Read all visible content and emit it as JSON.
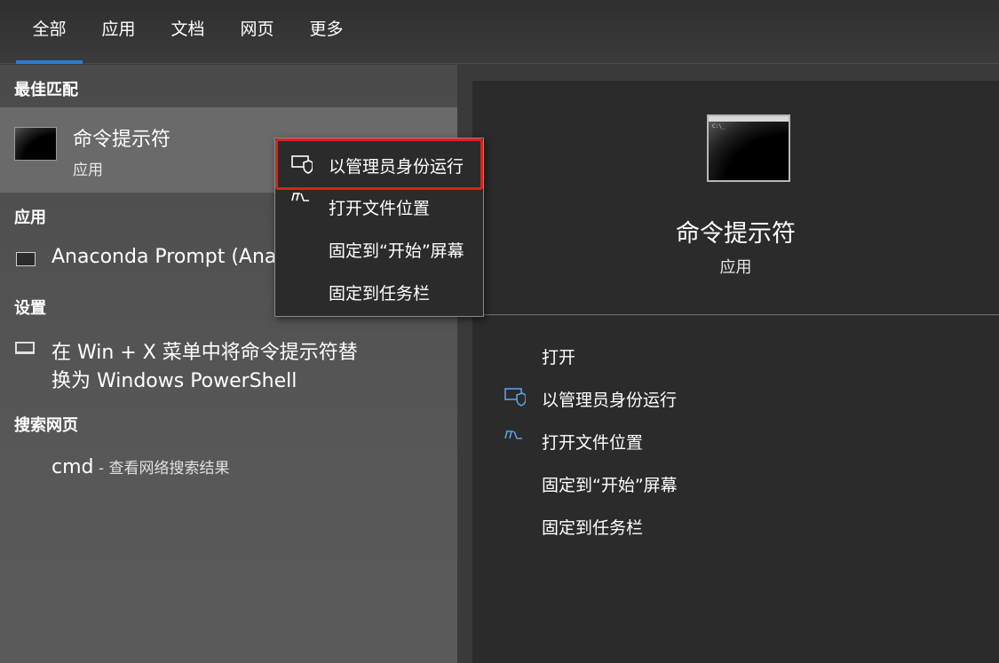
{
  "tabs": [
    {
      "label": "全部",
      "active": true
    },
    {
      "label": "应用",
      "active": false
    },
    {
      "label": "文档",
      "active": false
    },
    {
      "label": "网页",
      "active": false
    },
    {
      "label": "更多",
      "active": false
    }
  ],
  "left": {
    "best_match_header": "最佳匹配",
    "best_match": {
      "title": "命令提示符",
      "subtitle": "应用",
      "icon": "cmd-icon"
    },
    "apps_header": "应用",
    "apps": [
      {
        "label": "Anaconda Prompt (Ana",
        "icon": "terminal-icon"
      }
    ],
    "settings_header": "设置",
    "settings": [
      {
        "line1": "在 Win + X 菜单中将命令提示符替",
        "line2": "换为 Windows PowerShell",
        "icon": "monitor-icon"
      }
    ],
    "web_header": "搜索网页",
    "web": {
      "query": "cmd",
      "suffix": " - 查看网络搜索结果"
    }
  },
  "context_menu": {
    "items": [
      {
        "label": "以管理员身份运行",
        "icon": "shield-icon"
      },
      {
        "label": "打开文件位置",
        "icon": "folder-icon"
      },
      {
        "label": "固定到“开始”屏幕",
        "icon": ""
      },
      {
        "label": "固定到任务栏",
        "icon": ""
      }
    ],
    "highlight_color": "#e0201c"
  },
  "right": {
    "title": "命令提示符",
    "subtitle": "应用",
    "actions": [
      {
        "label": "打开",
        "icon": ""
      },
      {
        "label": "以管理员身份运行",
        "icon": "shield-icon"
      },
      {
        "label": "打开文件位置",
        "icon": "folder-icon"
      },
      {
        "label": "固定到“开始”屏幕",
        "icon": ""
      },
      {
        "label": "固定到任务栏",
        "icon": ""
      }
    ]
  },
  "colors": {
    "accent": "#2b7cd3",
    "icon_blue": "#5aa0e6"
  }
}
